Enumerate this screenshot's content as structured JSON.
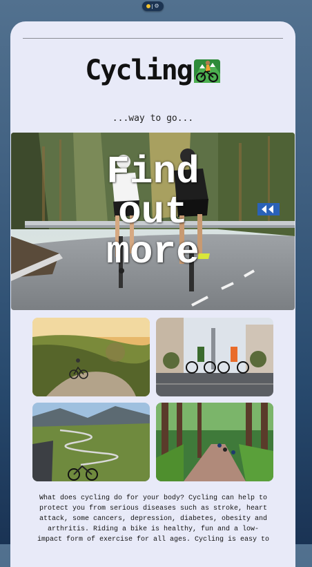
{
  "status_pill": {
    "icons": [
      "yellow-dot",
      "separator",
      "gear-icon"
    ]
  },
  "header": {
    "title": "Cycling",
    "title_emoji": "mountain-biker-icon",
    "tagline": "...way to go..."
  },
  "hero": {
    "overlay_text_line1": "Find",
    "overlay_text_line2": "out",
    "overlay_text_line3": "more",
    "image_subject": "two road cyclists riding on a mountain road"
  },
  "gallery": [
    {
      "subject": "cyclist on a hillside path at sunset"
    },
    {
      "subject": "cyclists with loaded bikes in a town street"
    },
    {
      "subject": "winding alpine pass road with parked bikes"
    },
    {
      "subject": "cyclists riding a forest trail"
    }
  ],
  "article": {
    "paragraph": "What does cycling do for your body? Cycling can help to protect you from serious diseases such as stroke, heart attack, some cancers, depression, diabetes, obesity and arthritis. Riding a bike is healthy, fun and a low-impact form of exercise for all ages. Cycling is easy to"
  },
  "colors": {
    "page_bg": "#3f5f80",
    "card_bg": "#e8eaf8",
    "text": "#111111"
  }
}
